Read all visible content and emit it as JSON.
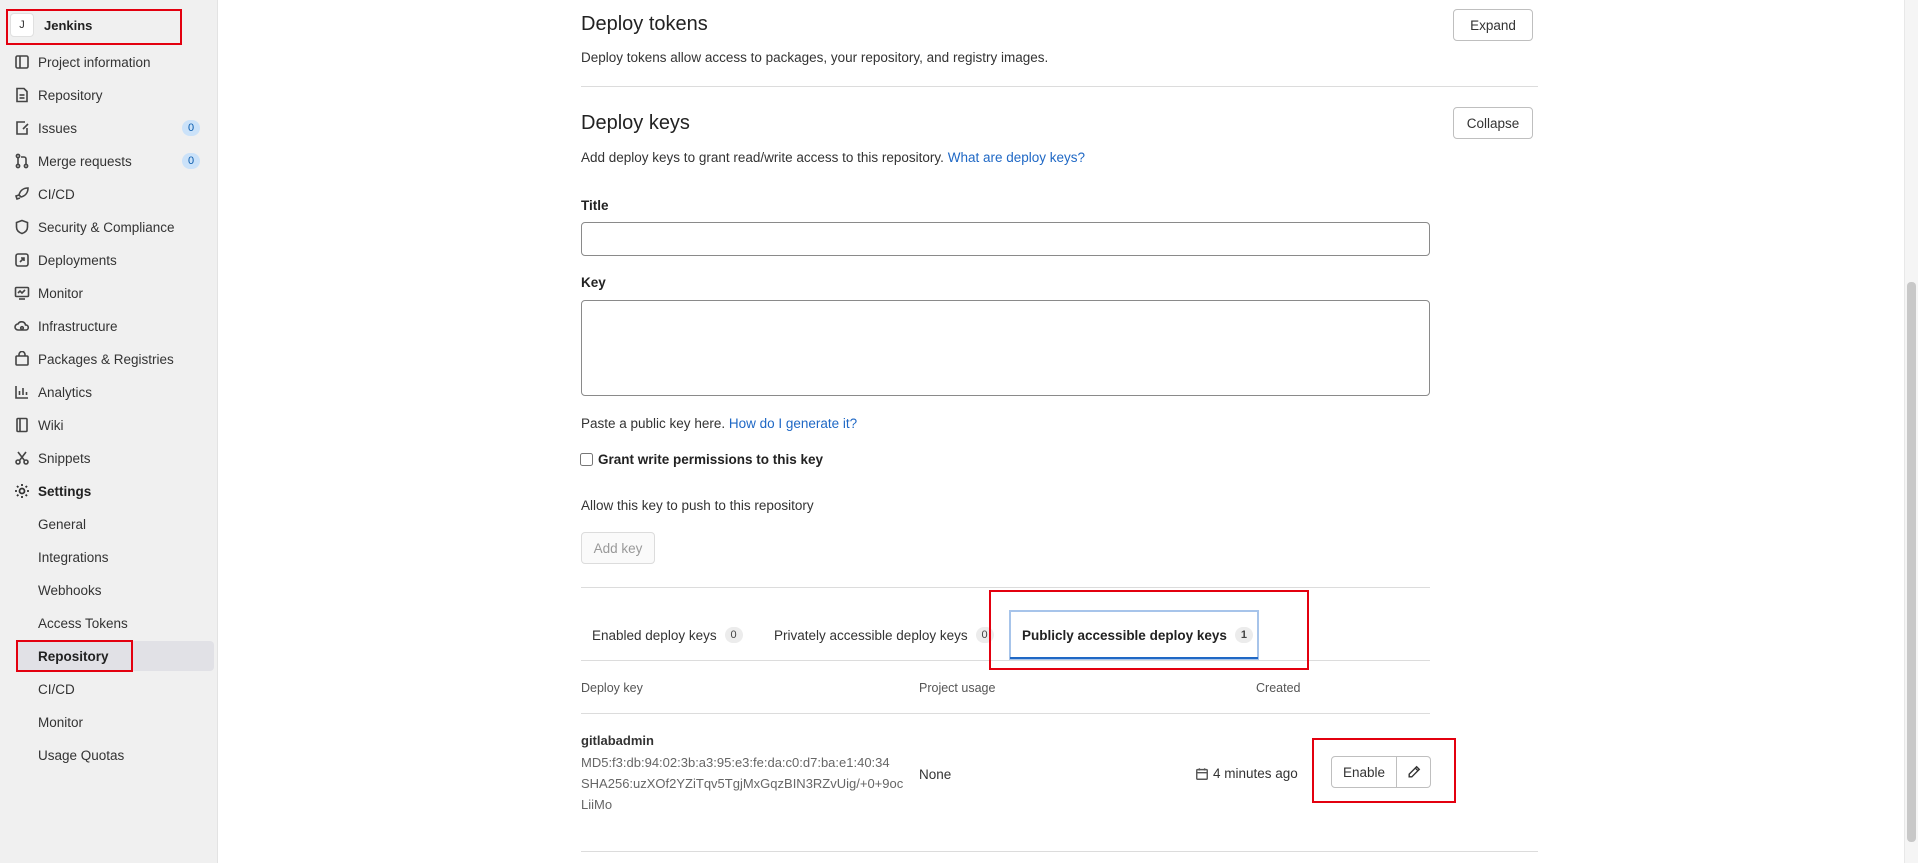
{
  "sidebar": {
    "project_avatar": "J",
    "project_name": "Jenkins",
    "items": [
      {
        "label": "Project information",
        "icon": "project-information-icon"
      },
      {
        "label": "Repository",
        "icon": "repository-file-icon"
      },
      {
        "label": "Issues",
        "icon": "issues-icon",
        "badge": "0"
      },
      {
        "label": "Merge requests",
        "icon": "merge-request-icon",
        "badge": "0"
      },
      {
        "label": "CI/CD",
        "icon": "rocket-icon"
      },
      {
        "label": "Security & Compliance",
        "icon": "shield-icon"
      },
      {
        "label": "Deployments",
        "icon": "deployments-icon"
      },
      {
        "label": "Monitor",
        "icon": "monitor-icon"
      },
      {
        "label": "Infrastructure",
        "icon": "cloud-gear-icon"
      },
      {
        "label": "Packages & Registries",
        "icon": "package-icon"
      },
      {
        "label": "Analytics",
        "icon": "analytics-icon"
      },
      {
        "label": "Wiki",
        "icon": "book-icon"
      },
      {
        "label": "Snippets",
        "icon": "scissors-icon"
      },
      {
        "label": "Settings",
        "icon": "gear-icon"
      }
    ],
    "settings_sub": [
      {
        "label": "General"
      },
      {
        "label": "Integrations"
      },
      {
        "label": "Webhooks"
      },
      {
        "label": "Access Tokens"
      },
      {
        "label": "Repository",
        "active": true
      },
      {
        "label": "CI/CD"
      },
      {
        "label": "Monitor"
      },
      {
        "label": "Usage Quotas"
      }
    ]
  },
  "deploy_tokens": {
    "title": "Deploy tokens",
    "description": "Deploy tokens allow access to packages, your repository, and registry images.",
    "expand_label": "Expand"
  },
  "deploy_keys": {
    "title": "Deploy keys",
    "description": "Add deploy keys to grant read/write access to this repository.",
    "help_link": "What are deploy keys?",
    "collapse_label": "Collapse",
    "title_label": "Title",
    "title_value": "",
    "key_label": "Key",
    "key_value": "",
    "paste_hint": "Paste a public key here.",
    "generate_link": "How do I generate it?",
    "grant_label": "Grant write permissions to this key",
    "grant_checked": false,
    "allow_text": "Allow this key to push to this repository",
    "add_key_label": "Add key",
    "tabs": [
      {
        "label": "Enabled deploy keys",
        "count": "0"
      },
      {
        "label": "Privately accessible deploy keys",
        "count": "0"
      },
      {
        "label": "Publicly accessible deploy keys",
        "count": "1",
        "active": true
      }
    ],
    "table": {
      "headers": [
        "Deploy key",
        "Project usage",
        "Created"
      ],
      "rows": [
        {
          "name": "gitlabadmin",
          "md5": "MD5:f3:db:94:02:3b:a3:95:e3:fe:da:c0:d7:ba:e1:40:34",
          "sha256_line1": "SHA256:uzXOf2YZiTqv5TgjMxGqzBIN3RZvUig/+0+9oc",
          "sha256_line2": "LiiMo",
          "project_usage": "None",
          "created": "4 minutes ago",
          "enable_label": "Enable"
        }
      ]
    }
  }
}
